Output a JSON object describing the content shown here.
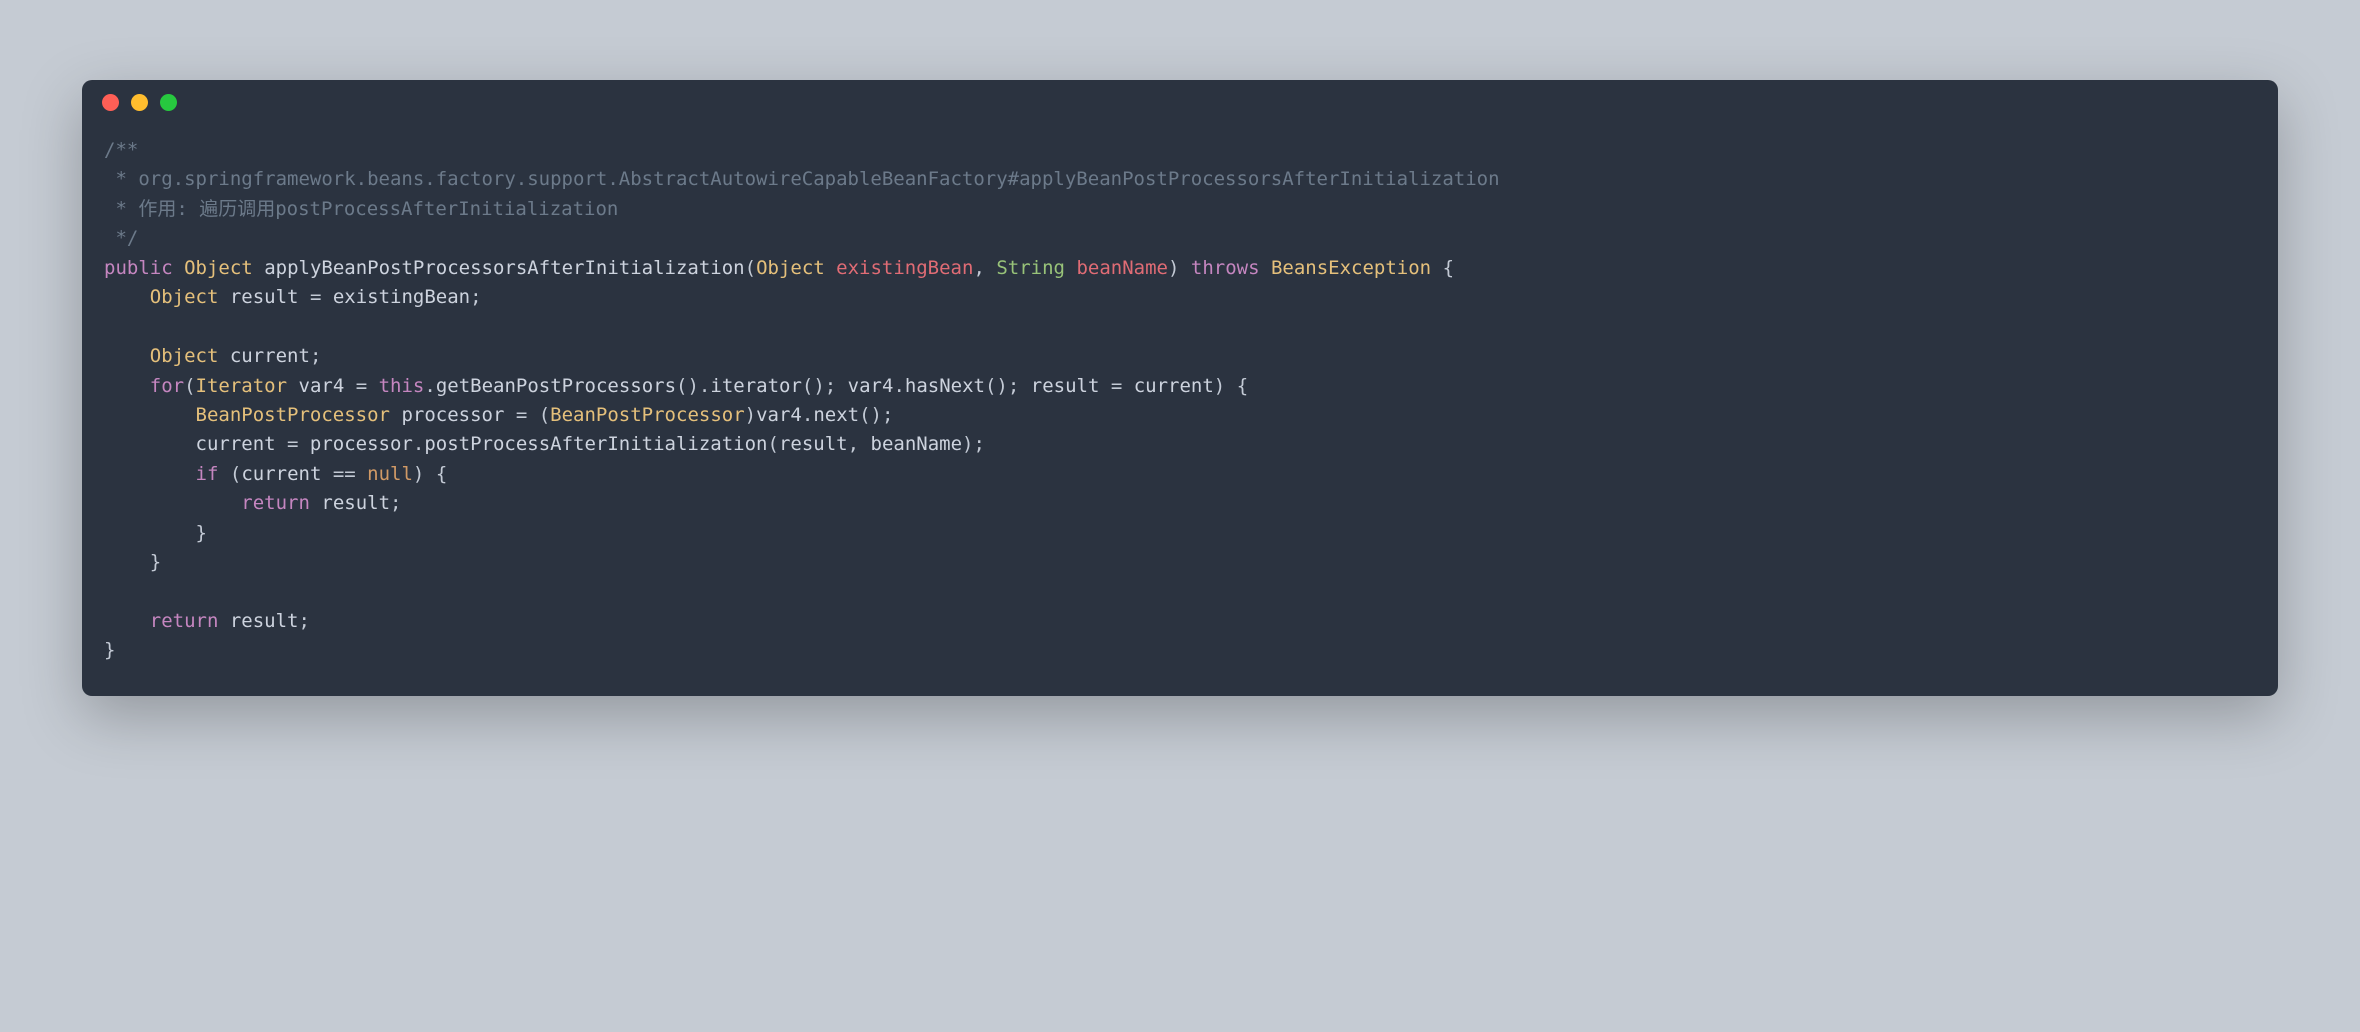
{
  "code": {
    "comment_start": "/**",
    "comment_line1": " * org.springframework.beans.factory.support.AbstractAutowireCapableBeanFactory#applyBeanPostProcessorsAfterInitialization",
    "comment_line2": " * 作用: 遍历调用postProcessAfterInitialization",
    "comment_end": " */",
    "kw_public": "public",
    "type_object": "Object",
    "method_name": "applyBeanPostProcessorsAfterInitialization",
    "param1_name": "existingBean",
    "type_string": "String",
    "param2_name": "beanName",
    "kw_throws": "throws",
    "type_exception": "BeansException",
    "var_result": "result",
    "var_existingBean": "existingBean",
    "var_current": "current",
    "kw_for": "for",
    "type_iterator": "Iterator",
    "var_var4": "var4",
    "kw_this": "this",
    "method_getBean": "getBeanPostProcessors",
    "method_iterator": "iterator",
    "method_hasNext": "hasNext",
    "type_beanpost": "BeanPostProcessor",
    "var_processor": "processor",
    "method_next": "next",
    "method_postProcess": "postProcessAfterInitialization",
    "kw_if": "if",
    "kw_null": "null",
    "kw_return": "return"
  }
}
